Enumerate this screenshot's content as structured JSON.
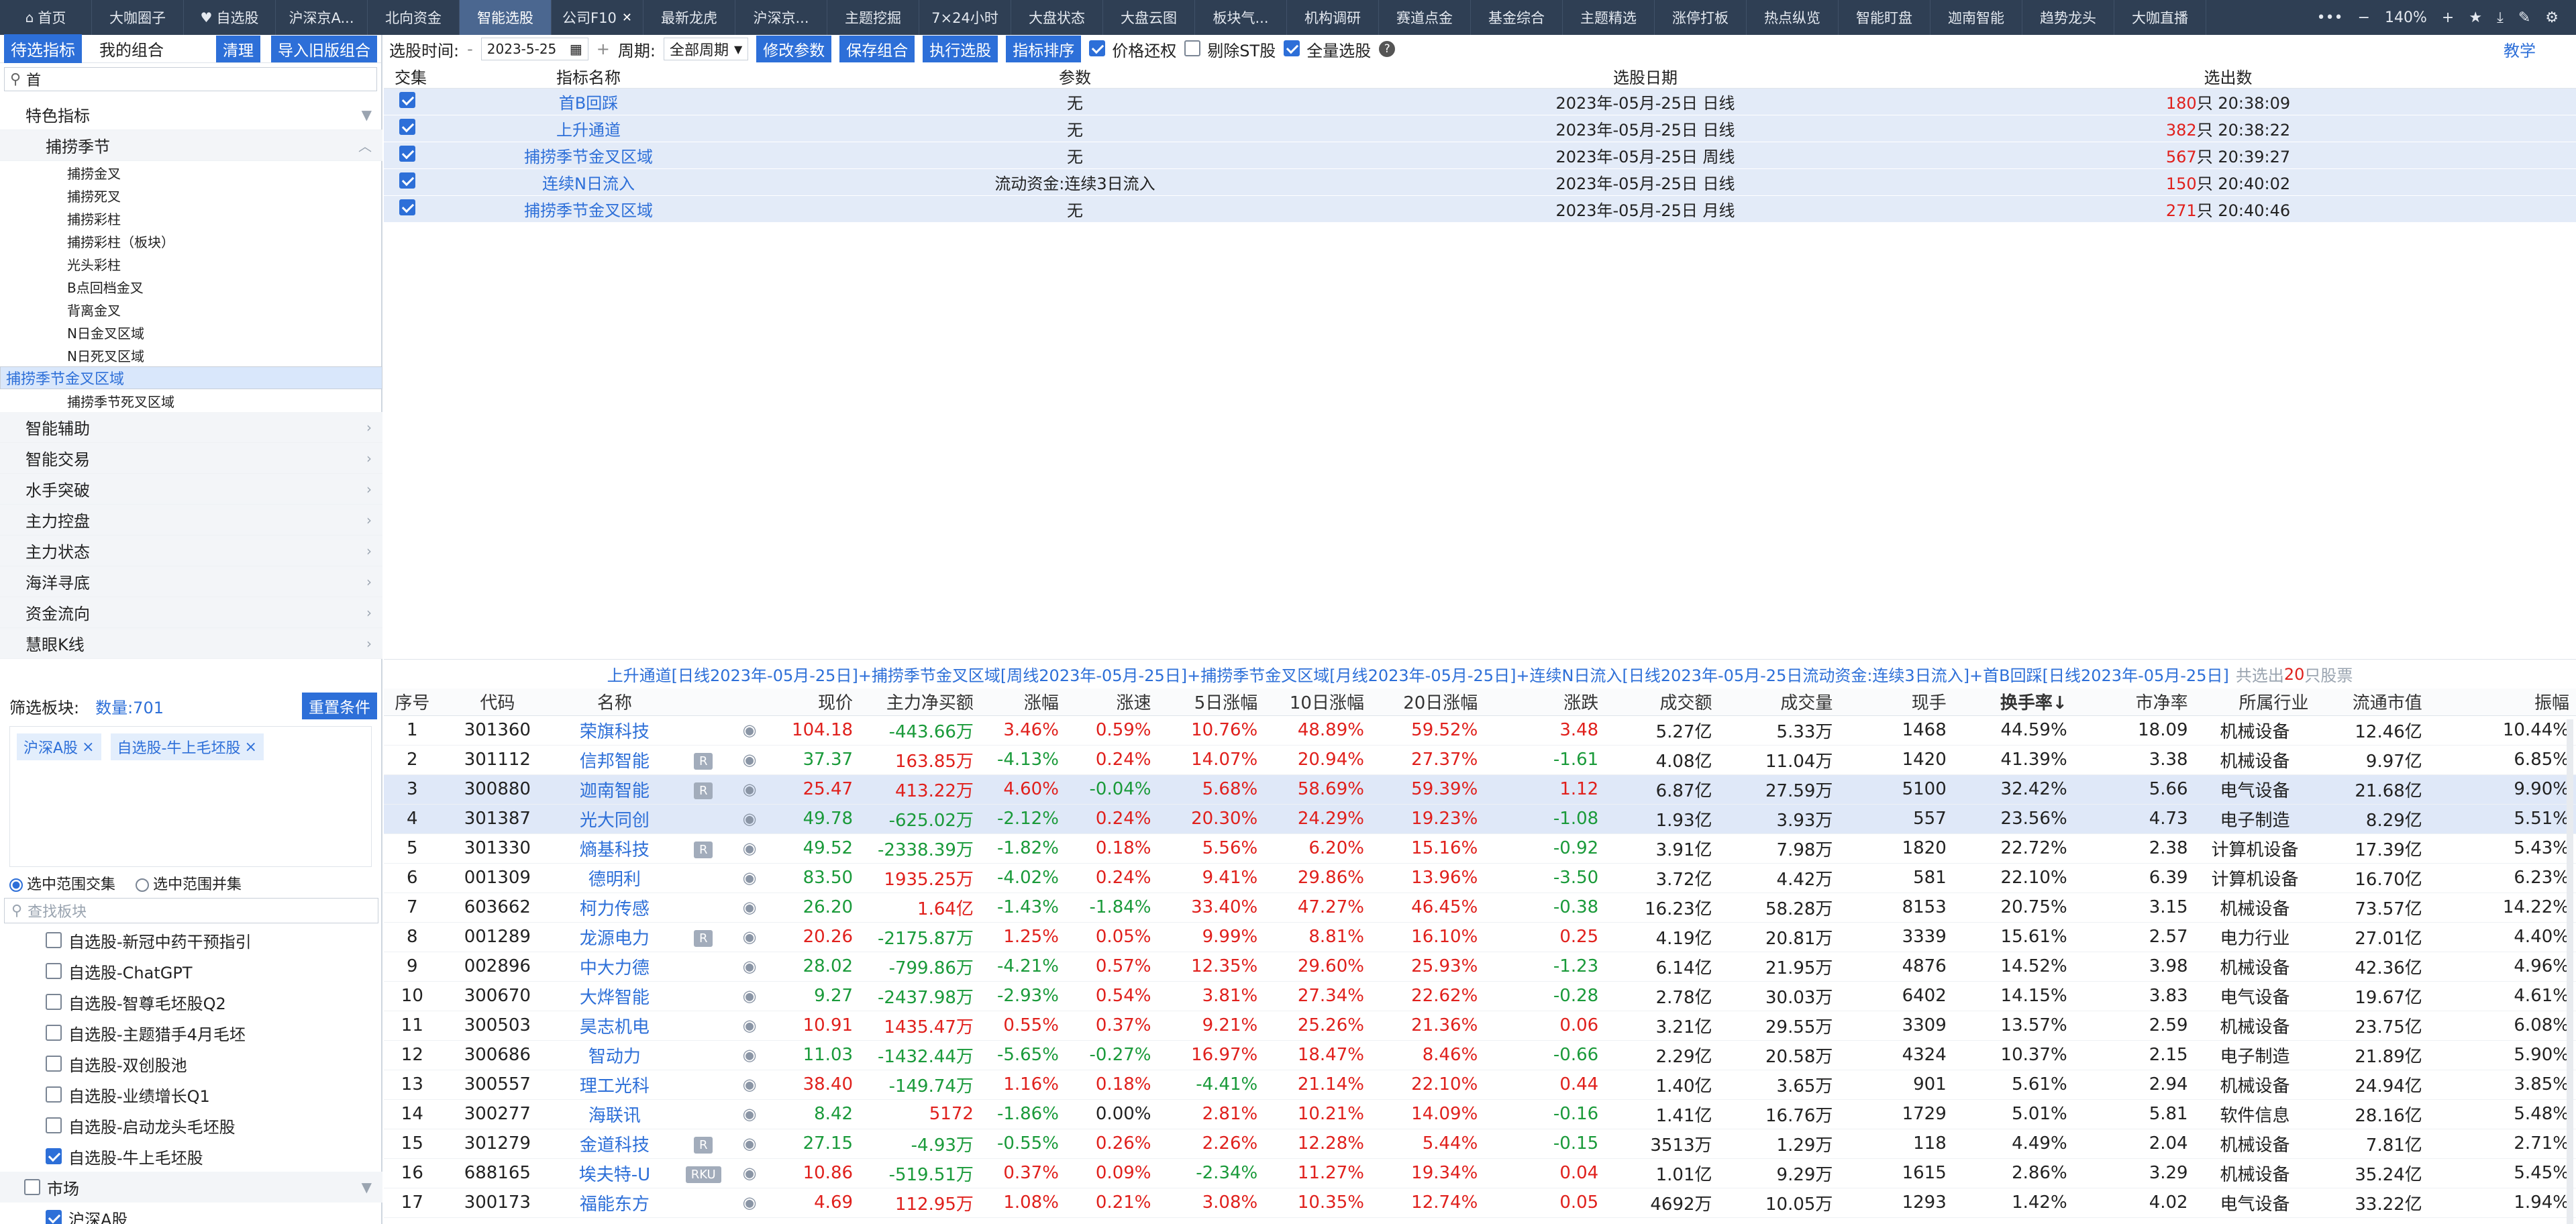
{
  "topbar": {
    "tabs": [
      "首页",
      "大咖圈子",
      "自选股",
      "沪深京A...",
      "北向资金",
      "智能选股",
      "公司F10",
      "最新龙虎",
      "沪深京...",
      "主题挖掘",
      "7×24小时",
      "大盘状态",
      "大盘云图",
      "板块气...",
      "机构调研",
      "赛道点金",
      "基金综合",
      "主题精选",
      "涨停打板",
      "热点纵览",
      "智能盯盘",
      "迦南智能",
      "趋势龙头",
      "大咖直播"
    ],
    "zoom": "140%"
  },
  "left": {
    "tab_pending": "待选指标",
    "tab_mine": "我的组合",
    "clear_btn": "清理",
    "import_btn": "导入旧版组合",
    "search_value": "首",
    "tree_root": "特色指标",
    "tree_group": "捕捞季节",
    "leaves": [
      "捕捞金叉",
      "捕捞死叉",
      "捕捞彩柱",
      "捕捞彩柱（板块）",
      "光头彩柱",
      "B点回档金叉",
      "背离金叉",
      "N日金叉区域",
      "N日死叉区域",
      "捕捞季节金叉区域",
      "捕捞季节死叉区域"
    ],
    "selected_leaf": "捕捞季节金叉区域",
    "categories": [
      "智能辅助",
      "智能交易",
      "水手突破",
      "主力控盘",
      "主力状态",
      "海洋寻底",
      "资金流向",
      "慧眼K线"
    ],
    "filter_label": "筛选板块:",
    "filter_count": "数量:701",
    "reset_btn": "重置条件",
    "chips": [
      "沪深A股",
      "自选股-牛上毛坯股"
    ],
    "radio_intersect": "选中范围交集",
    "radio_union": "选中范围并集",
    "board_search_placeholder": "查找板块",
    "boards": [
      {
        "label": "自选股-新冠中药干预指引",
        "checked": false
      },
      {
        "label": "自选股-ChatGPT",
        "checked": false
      },
      {
        "label": "自选股-智尊毛坯股Q2",
        "checked": false
      },
      {
        "label": "自选股-主题猎手4月毛坯",
        "checked": false
      },
      {
        "label": "自选股-双创股池",
        "checked": false
      },
      {
        "label": "自选股-业绩增长Q1",
        "checked": false
      },
      {
        "label": "自选股-启动龙头毛坯股",
        "checked": false
      },
      {
        "label": "自选股-牛上毛坯股",
        "checked": true
      }
    ],
    "market_group": "市场",
    "market_items": [
      {
        "label": "沪深A股",
        "checked": true
      }
    ]
  },
  "toolbar": {
    "date_label": "选股时间:",
    "date_value": "2023-5-25",
    "period_label": "周期:",
    "period_value": "全部周期",
    "btn_modify": "修改参数",
    "btn_save": "保存组合",
    "btn_run": "执行选股",
    "btn_sort": "指标排序",
    "chk_price": "价格还权",
    "chk_st": "剔除ST股",
    "chk_all": "全量选股",
    "teach": "教学"
  },
  "formula_table": {
    "headers": [
      "交集",
      "指标名称",
      "参数",
      "选股日期",
      "选出数"
    ],
    "rows": [
      {
        "name": "首B回踩",
        "param": "无",
        "date": "2023年-05月-25日 日线",
        "count": "180",
        "time": "只 20:38:09"
      },
      {
        "name": "上升通道",
        "param": "无",
        "date": "2023年-05月-25日 日线",
        "count": "382",
        "time": "只 20:38:22"
      },
      {
        "name": "捕捞季节金叉区域",
        "param": "无",
        "date": "2023年-05月-25日 周线",
        "count": "567",
        "time": "只 20:39:27"
      },
      {
        "name": "连续N日流入",
        "param": "流动资金:连续3日流入",
        "date": "2023年-05月-25日 日线",
        "count": "150",
        "time": "只 20:40:02"
      },
      {
        "name": "捕捞季节金叉区域",
        "param": "无",
        "date": "2023年-05月-25日 月线",
        "count": "271",
        "time": "只 20:40:46"
      }
    ]
  },
  "summary": {
    "text": "上升通道[日线2023年-05月-25日]+捕捞季节金叉区域[周线2023年-05月-25日]+捕捞季节金叉区域[月线2023年-05月-25日]+连续N日流入[日线2023年-05月-25日流动资金:连续3日流入]+首B回踩[日线2023年-05月-25日]",
    "prefix": "共选出",
    "count": "20",
    "suffix": "只股票"
  },
  "stock_table": {
    "headers": [
      "序号",
      "代码",
      "名称",
      "",
      "",
      "现价",
      "主力净买额",
      "涨幅",
      "涨速",
      "5日涨幅",
      "10日涨幅",
      "20日涨幅",
      "涨跌",
      "成交额",
      "成交量",
      "现手",
      "换手率↓",
      "市净率",
      "所属行业",
      "流通市值",
      "振幅"
    ],
    "rows": [
      [
        "1",
        "301360",
        "荣旗科技",
        "",
        "104.18",
        "-443.66万",
        "3.46%",
        "0.59%",
        "10.76%",
        "48.89%",
        "59.52%",
        "3.48",
        "5.27亿",
        "5.33万",
        "1468",
        "44.59%",
        "18.09",
        "机械设备",
        "12.46亿",
        "10.44%"
      ],
      [
        "2",
        "301112",
        "信邦智能",
        "R",
        "37.37",
        "163.85万",
        "-4.13%",
        "0.24%",
        "14.07%",
        "20.94%",
        "27.37%",
        "-1.61",
        "4.08亿",
        "11.04万",
        "1420",
        "41.39%",
        "3.38",
        "机械设备",
        "9.97亿",
        "6.85%"
      ],
      [
        "3",
        "300880",
        "迦南智能",
        "R",
        "25.47",
        "413.22万",
        "4.60%",
        "-0.04%",
        "5.68%",
        "58.69%",
        "59.39%",
        "1.12",
        "6.87亿",
        "27.59万",
        "5100",
        "32.42%",
        "5.66",
        "电气设备",
        "21.68亿",
        "9.90%"
      ],
      [
        "4",
        "301387",
        "光大同创",
        "",
        "49.78",
        "-625.02万",
        "-2.12%",
        "0.24%",
        "20.30%",
        "24.29%",
        "19.23%",
        "-1.08",
        "1.93亿",
        "3.93万",
        "557",
        "23.56%",
        "4.73",
        "电子制造",
        "8.29亿",
        "5.51%"
      ],
      [
        "5",
        "301330",
        "熵基科技",
        "R",
        "49.52",
        "-2338.39万",
        "-1.82%",
        "0.18%",
        "5.56%",
        "6.20%",
        "15.16%",
        "-0.92",
        "3.91亿",
        "7.98万",
        "1820",
        "22.72%",
        "2.38",
        "计算机设备",
        "17.39亿",
        "5.43%"
      ],
      [
        "6",
        "001309",
        "德明利",
        "",
        "83.50",
        "1935.25万",
        "-4.02%",
        "0.24%",
        "9.41%",
        "29.86%",
        "13.96%",
        "-3.50",
        "3.72亿",
        "4.42万",
        "581",
        "22.10%",
        "6.39",
        "计算机设备",
        "16.70亿",
        "6.23%"
      ],
      [
        "7",
        "603662",
        "柯力传感",
        "",
        "26.20",
        "1.64亿",
        "-1.43%",
        "-1.84%",
        "33.40%",
        "47.27%",
        "46.45%",
        "-0.38",
        "16.23亿",
        "58.28万",
        "8153",
        "20.75%",
        "3.15",
        "机械设备",
        "73.57亿",
        "14.22%"
      ],
      [
        "8",
        "001289",
        "龙源电力",
        "R",
        "20.26",
        "-2175.87万",
        "1.25%",
        "0.05%",
        "9.99%",
        "8.81%",
        "16.10%",
        "0.25",
        "4.19亿",
        "20.81万",
        "3339",
        "15.61%",
        "2.57",
        "电力行业",
        "27.01亿",
        "4.40%"
      ],
      [
        "9",
        "002896",
        "中大力德",
        "",
        "28.02",
        "-799.86万",
        "-4.21%",
        "0.57%",
        "12.35%",
        "29.60%",
        "25.93%",
        "-1.23",
        "6.14亿",
        "21.95万",
        "4876",
        "14.52%",
        "3.98",
        "机械设备",
        "42.36亿",
        "4.96%"
      ],
      [
        "10",
        "300670",
        "大烨智能",
        "",
        "9.27",
        "-2437.98万",
        "-2.93%",
        "0.54%",
        "3.81%",
        "27.34%",
        "22.62%",
        "-0.28",
        "2.78亿",
        "30.03万",
        "6402",
        "14.15%",
        "3.83",
        "电气设备",
        "19.67亿",
        "4.61%"
      ],
      [
        "11",
        "300503",
        "昊志机电",
        "",
        "10.91",
        "1435.47万",
        "0.55%",
        "0.37%",
        "9.21%",
        "25.26%",
        "21.36%",
        "0.06",
        "3.21亿",
        "29.55万",
        "3309",
        "13.57%",
        "2.59",
        "机械设备",
        "23.75亿",
        "6.08%"
      ],
      [
        "12",
        "300686",
        "智动力",
        "",
        "11.03",
        "-1432.44万",
        "-5.65%",
        "-0.27%",
        "16.97%",
        "18.47%",
        "8.46%",
        "-0.66",
        "2.29亿",
        "20.58万",
        "4324",
        "10.37%",
        "2.15",
        "电子制造",
        "21.89亿",
        "5.90%"
      ],
      [
        "13",
        "300557",
        "理工光科",
        "",
        "38.40",
        "-149.74万",
        "1.16%",
        "0.18%",
        "-4.41%",
        "21.14%",
        "22.10%",
        "0.44",
        "1.40亿",
        "3.65万",
        "901",
        "5.61%",
        "2.94",
        "机械设备",
        "24.94亿",
        "3.85%"
      ],
      [
        "14",
        "300277",
        "海联讯",
        "",
        "8.42",
        "5172",
        "-1.86%",
        "0.00%",
        "2.81%",
        "10.21%",
        "14.09%",
        "-0.16",
        "1.41亿",
        "16.76万",
        "1729",
        "5.01%",
        "5.81",
        "软件信息",
        "28.16亿",
        "5.48%"
      ],
      [
        "15",
        "301279",
        "金道科技",
        "R",
        "27.15",
        "-4.93万",
        "-0.55%",
        "0.26%",
        "2.26%",
        "12.28%",
        "5.44%",
        "-0.15",
        "3513万",
        "1.29万",
        "118",
        "4.49%",
        "2.04",
        "机械设备",
        "7.81亿",
        "2.71%"
      ],
      [
        "16",
        "688165",
        "埃夫特-U",
        "RKU",
        "10.86",
        "-519.51万",
        "0.37%",
        "0.09%",
        "-2.34%",
        "11.27%",
        "19.34%",
        "0.04",
        "1.01亿",
        "9.29万",
        "1615",
        "2.86%",
        "3.29",
        "机械设备",
        "35.24亿",
        "5.45%"
      ],
      [
        "17",
        "300173",
        "福能东方",
        "",
        "4.69",
        "112.95万",
        "1.08%",
        "0.21%",
        "3.08%",
        "10.35%",
        "12.74%",
        "0.05",
        "4692万",
        "10.05万",
        "1293",
        "1.42%",
        "4.02",
        "电气设备",
        "33.22亿",
        "1.94%"
      ]
    ],
    "highlight_rows": [
      2,
      3
    ]
  },
  "colors": {
    "accent": "#2d6fd8",
    "up": "#e0201c",
    "down": "#1a9a3a",
    "topbar": "#2f3f54"
  }
}
